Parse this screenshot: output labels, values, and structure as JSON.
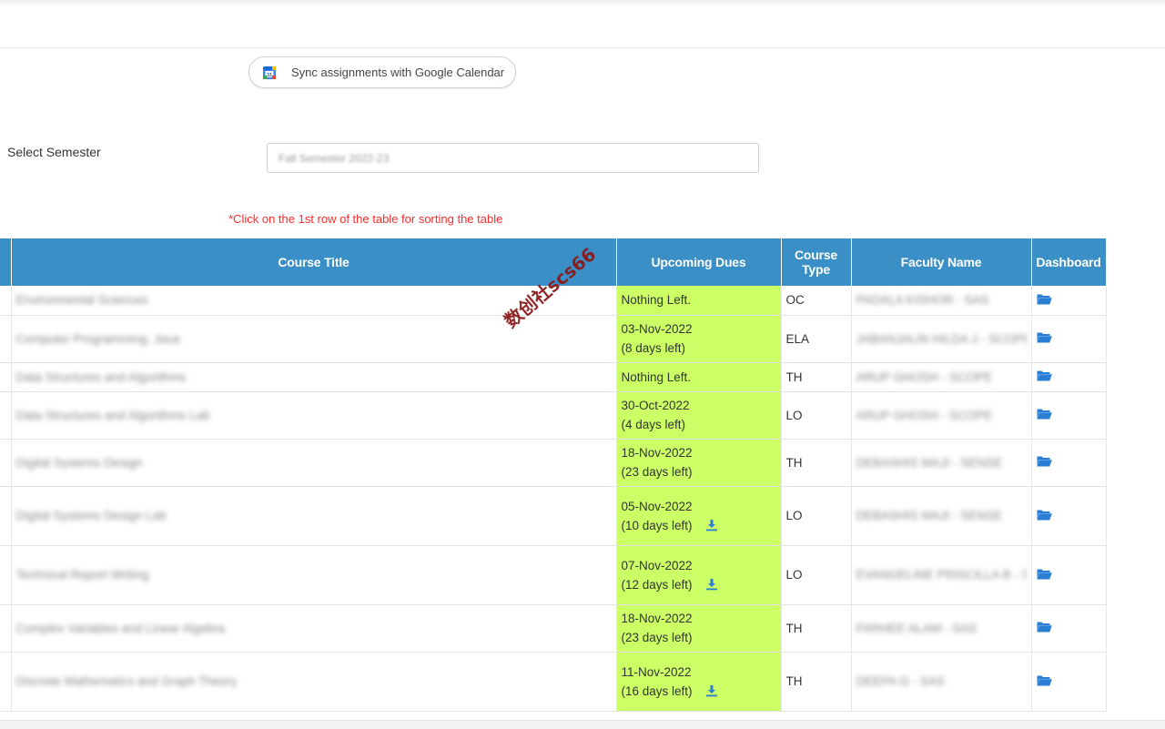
{
  "sync": {
    "label": "Sync assignments with Google Calendar",
    "icon": "google-calendar-icon"
  },
  "semester": {
    "label": "Select Semester",
    "value": "Fall Semester 2022-23"
  },
  "hint": "*Click on the 1st row of the table for sorting the table",
  "table": {
    "headers": {
      "title": "Course Title",
      "dues": "Upcoming Dues",
      "type_line1": "Course",
      "type_line2": "Type",
      "faculty": "Faculty Name",
      "dashboard": "Dashboard"
    },
    "rows": [
      {
        "title": "Environmental Sciences",
        "due_date": "Nothing Left.",
        "due_left": "",
        "download": false,
        "type": "OC",
        "faculty": "PADALA KISHOR - SAS"
      },
      {
        "title": "Computer Programming: Java",
        "due_date": "03-Nov-2022",
        "due_left": "(8 days left)",
        "download": false,
        "type": "ELA",
        "faculty": "JABANJALIN HILDA J - SCOPE"
      },
      {
        "title": "Data Structures and Algorithms",
        "due_date": "Nothing Left.",
        "due_left": "",
        "download": false,
        "type": "TH",
        "faculty": "ARUP GHOSH - SCOPE"
      },
      {
        "title": "Data Structures and Algorithms Lab",
        "due_date": "30-Oct-2022",
        "due_left": "(4 days left)",
        "download": false,
        "type": "LO",
        "faculty": "ARUP GHOSH - SCOPE"
      },
      {
        "title": "Digital Systems Design",
        "due_date": "18-Nov-2022",
        "due_left": "(23 days left)",
        "download": false,
        "type": "TH",
        "faculty": "DEBASHIS MAJI - SENSE"
      },
      {
        "title": "Digital Systems Design Lab",
        "due_date": "05-Nov-2022",
        "due_left": "(10 days left)",
        "download": true,
        "type": "LO",
        "faculty": "DEBASHIS MAJI - SENSE"
      },
      {
        "title": "Technical Report Writing",
        "due_date": "07-Nov-2022",
        "due_left": "(12 days left)",
        "download": true,
        "type": "LO",
        "faculty": "EVANGELINE PRISCILLA B - SSL"
      },
      {
        "title": "Complex Variables and Linear Algebra",
        "due_date": "18-Nov-2022",
        "due_left": "(23 days left)",
        "download": false,
        "type": "TH",
        "faculty": "FARHEE ALAM - SAS"
      },
      {
        "title": "Discrete Mathematics and Graph Theory",
        "due_date": "11-Nov-2022",
        "due_left": "(16 days left)",
        "download": true,
        "type": "TH",
        "faculty": "DEEPA G - SAS"
      }
    ]
  },
  "watermark": "数创社scs66",
  "colors": {
    "header": "#3a8fc7",
    "dues_bg": "#ccff66",
    "hint": "#ff2b2b",
    "icon": "#2a7fd4"
  }
}
